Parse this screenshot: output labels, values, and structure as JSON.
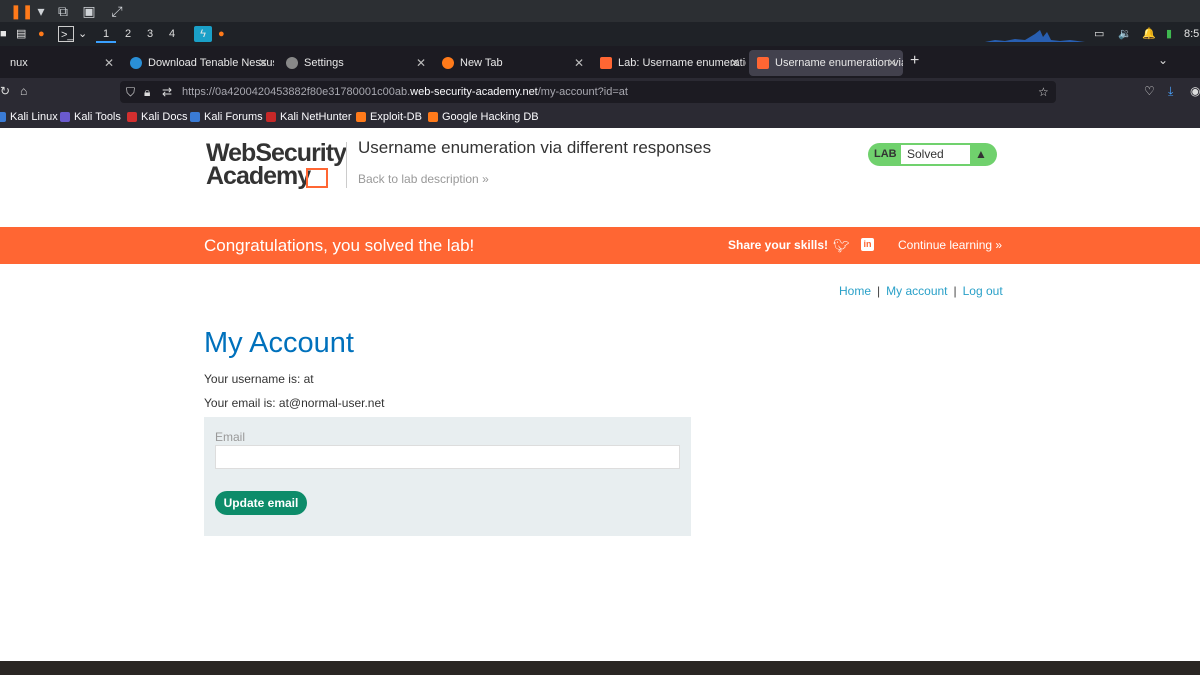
{
  "workspaces": [
    "1",
    "2",
    "3",
    "4"
  ],
  "tabs": [
    {
      "label": "nux",
      "favicon_color": "#1c1b22"
    },
    {
      "label": "Download Tenable Nessus",
      "favicon_color": "#2a8fd6"
    },
    {
      "label": "Settings",
      "favicon_color": "#888888"
    },
    {
      "label": "New Tab",
      "favicon_color": "#ff7a1a"
    },
    {
      "label": "Lab: Username enumeration",
      "favicon_color": "#ff6633"
    },
    {
      "label": "Username enumeration via",
      "favicon_color": "#ff6633"
    }
  ],
  "url": {
    "prefix": "https://0a4200420453882f80e31780001c00ab.",
    "domain": "web-security-academy.net",
    "path": "/my-account?id=at"
  },
  "bookmarks": [
    {
      "label": "Kali Linux",
      "color": "#3a7bd5"
    },
    {
      "label": "Kali Tools",
      "color": "#6a5acd"
    },
    {
      "label": "Kali Docs",
      "color": "#d32f2f"
    },
    {
      "label": "Kali Forums",
      "color": "#3a7bd5"
    },
    {
      "label": "Kali NetHunter",
      "color": "#c62828"
    },
    {
      "label": "Exploit-DB",
      "color": "#ff7a1a"
    },
    {
      "label": "Google Hacking DB",
      "color": "#ff7a1a"
    }
  ],
  "header": {
    "logo_line1": "WebSecurity",
    "logo_line2": "Academy",
    "lab_title": "Username enumeration via different responses",
    "back_link": "Back to lab description »",
    "badge_label": "LAB",
    "badge_status": "Solved"
  },
  "banner": {
    "message": "Congratulations, you solved the lab!",
    "share_label": "Share your skills!",
    "continue_label": "Continue learning »"
  },
  "nav": {
    "home": "Home",
    "my_account": "My account",
    "logout": "Log out"
  },
  "account": {
    "title": "My Account",
    "username_line": "Your username is: at",
    "email_line": "Your email is: at@normal-user.net",
    "email_label": "Email",
    "email_value": "",
    "update_button": "Update email"
  },
  "colors": {
    "accent": "#ff6633",
    "link": "#29a0c8",
    "heading": "#0071bc",
    "badge": "#70d16d",
    "button": "#0d8c6a"
  }
}
